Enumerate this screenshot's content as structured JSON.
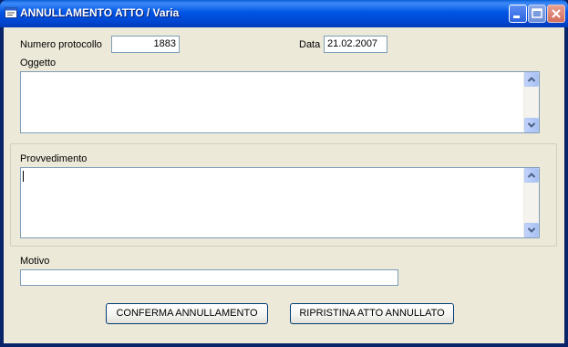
{
  "window": {
    "title": "ANNULLAMENTO ATTO / Varia"
  },
  "form": {
    "protocollo_label": "Numero protocollo",
    "protocollo_value": "1883",
    "data_label": "Data",
    "data_value": "21.02.2007",
    "oggetto_label": "Oggetto",
    "provvedimento_label": "Provvedimento",
    "motivo_label": "Motivo"
  },
  "buttons": {
    "conferma": "CONFERMA ANNULLAMENTO",
    "ripristina": "RIPRISTINA ATTO ANNULLATO"
  }
}
